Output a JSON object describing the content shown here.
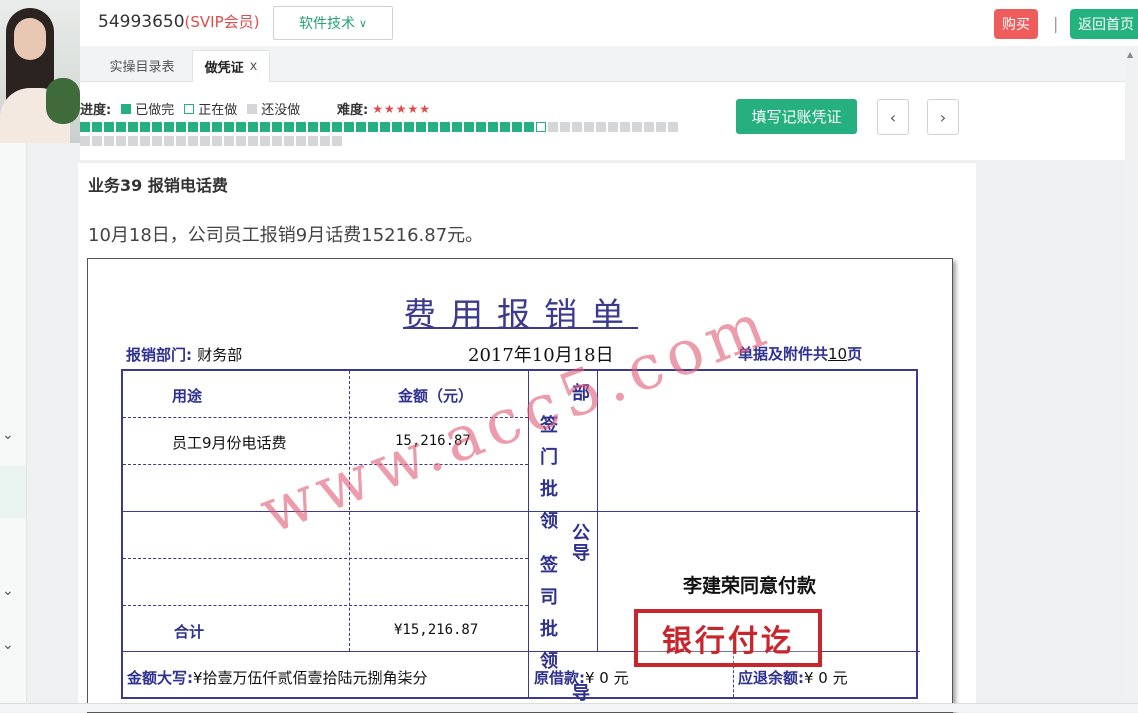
{
  "header": {
    "account": "54993650",
    "vip": "(SVIP会员)",
    "tech_menu": "软件技术",
    "buy": "购买",
    "separator": "|",
    "home": "返回首页"
  },
  "tabs": [
    {
      "label": "实操目录表"
    },
    {
      "label": "做凭证",
      "close": "x"
    }
  ],
  "progress": {
    "label": "进度:",
    "done_label": "已做完",
    "doing_label": "正在做",
    "todo_label": "还没做",
    "difficulty_label": "难度:",
    "difficulty_stars": "★★★★★",
    "difficulty_level": 5,
    "done_count": 38,
    "current_index": 39,
    "total": 72,
    "colors": {
      "done": "#26b07f",
      "doing": "#ffffff",
      "todo": "#d4d6d8"
    }
  },
  "actions": {
    "fill_voucher": "填写记账凭证",
    "prev": "‹",
    "next": "›"
  },
  "business": {
    "title": "业务39 报销电话费",
    "description": "10月18日，公司员工报销9月话费15216.87元。"
  },
  "form": {
    "title": "费用报销单",
    "dept_label": "报销部门:",
    "dept": "财务部",
    "date": "2017年10月18日",
    "attach_prefix": "单据及附件共",
    "attach_count": "10",
    "attach_suffix": "页",
    "col_purpose": "用途",
    "col_amount": "金额（元）",
    "dept_approval": [
      "部",
      "签门",
      "批领",
      "导"
    ],
    "company_approval": [
      "公",
      "签司",
      "批领",
      "导"
    ],
    "rows": [
      {
        "purpose": "员工9月份电话费",
        "amount": "15,216.87"
      },
      {
        "purpose": "",
        "amount": ""
      },
      {
        "purpose": "",
        "amount": ""
      },
      {
        "purpose": "",
        "amount": ""
      }
    ],
    "total_label": "合计",
    "total_amount": "¥15,216.87",
    "approval_note": "李建荣同意付款",
    "stamp": "银行付讫",
    "capital_label": "金额大写:",
    "capital_value": "¥拾壹万伍仟贰佰壹拾陆元捌角柒分",
    "borrow_label": "原借款:",
    "borrow_value": "¥  0  元",
    "refund_label": "应退余额:",
    "refund_value": "¥  0  元",
    "watermark": "www.acc5.com"
  }
}
